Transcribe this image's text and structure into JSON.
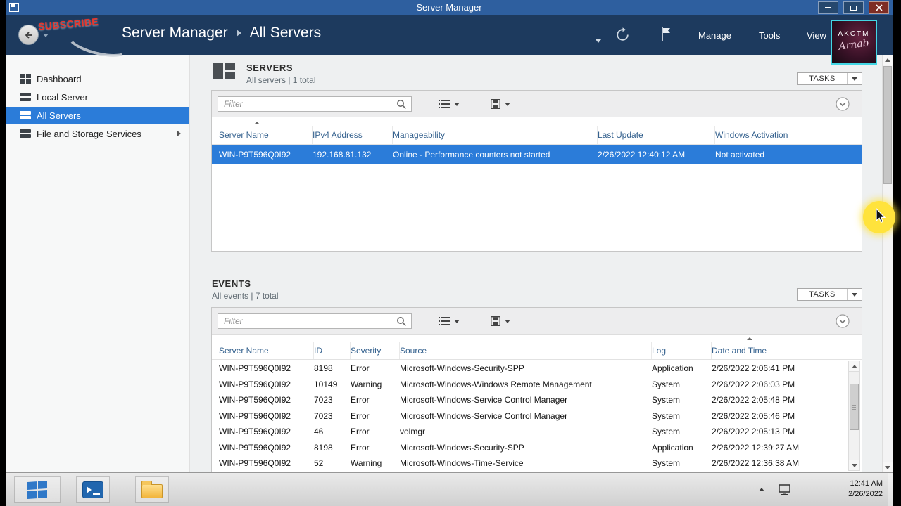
{
  "window": {
    "title": "Server Manager"
  },
  "nav": {
    "breadcrumb": {
      "root": "Server Manager",
      "current": "All Servers"
    },
    "menu_items": [
      "Manage",
      "Tools",
      "View"
    ],
    "watermark": "SUBSCRIBE",
    "logo": {
      "title": "AKCTM",
      "signature": "Arnab"
    }
  },
  "sidebar": {
    "items": [
      {
        "label": "Dashboard"
      },
      {
        "label": "Local Server"
      },
      {
        "label": "All Servers"
      },
      {
        "label": "File and Storage Services"
      }
    ]
  },
  "servers": {
    "title": "SERVERS",
    "subtitle": "All servers | 1 total",
    "tasks_label": "TASKS",
    "filter_placeholder": "Filter",
    "columns": [
      "Server Name",
      "IPv4 Address",
      "Manageability",
      "Last Update",
      "Windows Activation"
    ],
    "row": {
      "name": "WIN-P9T596Q0I92",
      "ipv4": "192.168.81.132",
      "manageability": "Online - Performance counters not started",
      "last_update": "2/26/2022 12:40:12 AM",
      "activation": "Not activated"
    }
  },
  "events": {
    "title": "EVENTS",
    "subtitle": "All events | 7 total",
    "tasks_label": "TASKS",
    "filter_placeholder": "Filter",
    "columns": [
      "Server Name",
      "ID",
      "Severity",
      "Source",
      "Log",
      "Date and Time"
    ],
    "rows": [
      {
        "name": "WIN-P9T596Q0I92",
        "id": "8198",
        "severity": "Error",
        "source": "Microsoft-Windows-Security-SPP",
        "log": "Application",
        "time": "2/26/2022 2:06:41 PM"
      },
      {
        "name": "WIN-P9T596Q0I92",
        "id": "10149",
        "severity": "Warning",
        "source": "Microsoft-Windows-Windows Remote Management",
        "log": "System",
        "time": "2/26/2022 2:06:03 PM"
      },
      {
        "name": "WIN-P9T596Q0I92",
        "id": "7023",
        "severity": "Error",
        "source": "Microsoft-Windows-Service Control Manager",
        "log": "System",
        "time": "2/26/2022 2:05:48 PM"
      },
      {
        "name": "WIN-P9T596Q0I92",
        "id": "7023",
        "severity": "Error",
        "source": "Microsoft-Windows-Service Control Manager",
        "log": "System",
        "time": "2/26/2022 2:05:46 PM"
      },
      {
        "name": "WIN-P9T596Q0I92",
        "id": "46",
        "severity": "Error",
        "source": "volmgr",
        "log": "System",
        "time": "2/26/2022 2:05:13 PM"
      },
      {
        "name": "WIN-P9T596Q0I92",
        "id": "8198",
        "severity": "Error",
        "source": "Microsoft-Windows-Security-SPP",
        "log": "Application",
        "time": "2/26/2022 12:39:27 AM"
      },
      {
        "name": "WIN-P9T596Q0I92",
        "id": "52",
        "severity": "Warning",
        "source": "Microsoft-Windows-Time-Service",
        "log": "System",
        "time": "2/26/2022 12:36:38 AM"
      }
    ]
  },
  "taskbar": {
    "time": "12:41 AM",
    "date": "2/26/2022"
  },
  "colors": {
    "titlebar": "#2e5f9f",
    "navbar": "#1d3a5e",
    "selection": "#2b7cd9",
    "header_text": "#34618e",
    "highlight": "#ffe33c"
  },
  "icons": {
    "search": "magnifier",
    "refresh": "circular-arrow",
    "notifications": "flag",
    "caret_down": "▾",
    "expand_right": "▸",
    "scroll_up": "▲",
    "scroll_down": "▼"
  }
}
